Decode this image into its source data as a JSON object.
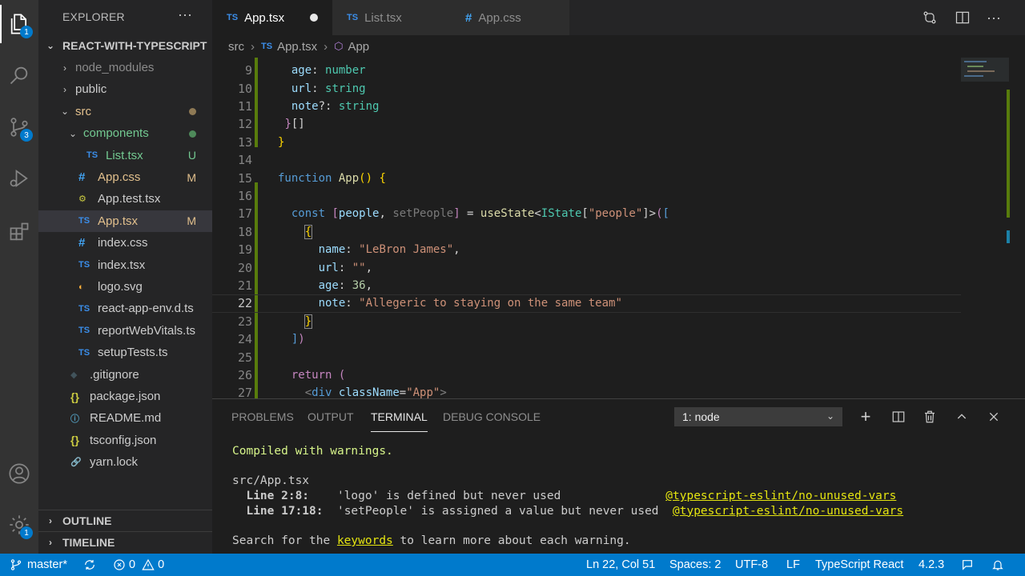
{
  "activity_bar": {
    "items": [
      {
        "name": "explorer",
        "badge": "1"
      },
      {
        "name": "search",
        "badge": ""
      },
      {
        "name": "source-control",
        "badge": "3"
      },
      {
        "name": "run-debug",
        "badge": ""
      },
      {
        "name": "extensions",
        "badge": ""
      }
    ],
    "bottom": [
      {
        "name": "accounts",
        "badge": ""
      },
      {
        "name": "manage",
        "badge": "1"
      }
    ]
  },
  "sidebar": {
    "title": "EXPLORER",
    "more": "···",
    "project": "REACT-WITH-TYPESCRIPT",
    "tree": [
      {
        "label": "node_modules",
        "type": "folder",
        "open": false,
        "color": "#8b8b8b",
        "status": ""
      },
      {
        "label": "public",
        "type": "folder",
        "open": false,
        "color": "#cccccc",
        "status": ""
      },
      {
        "label": "src",
        "type": "folder",
        "open": true,
        "color": "#e2c08d",
        "status": "dot"
      },
      {
        "label": "components",
        "type": "folder",
        "open": true,
        "color": "#73c991",
        "status": "dot-green"
      },
      {
        "label": "List.tsx",
        "type": "ts",
        "color": "#73c991",
        "status": "U"
      },
      {
        "label": "App.css",
        "type": "css",
        "color": "#e2c08d",
        "status": "M"
      },
      {
        "label": "App.test.tsx",
        "type": "test",
        "color": "#cccccc",
        "status": ""
      },
      {
        "label": "App.tsx",
        "type": "ts",
        "color": "#e2c08d",
        "status": "M"
      },
      {
        "label": "index.css",
        "type": "css",
        "color": "#cccccc",
        "status": ""
      },
      {
        "label": "index.tsx",
        "type": "ts",
        "color": "#cccccc",
        "status": ""
      },
      {
        "label": "logo.svg",
        "type": "svg",
        "color": "#cccccc",
        "status": ""
      },
      {
        "label": "react-app-env.d.ts",
        "type": "ts",
        "color": "#cccccc",
        "status": ""
      },
      {
        "label": "reportWebVitals.ts",
        "type": "ts",
        "color": "#cccccc",
        "status": ""
      },
      {
        "label": "setupTests.ts",
        "type": "ts",
        "color": "#cccccc",
        "status": ""
      },
      {
        "label": ".gitignore",
        "type": "git",
        "color": "#cccccc",
        "status": ""
      },
      {
        "label": "package.json",
        "type": "json",
        "color": "#cccccc",
        "status": ""
      },
      {
        "label": "README.md",
        "type": "info",
        "color": "#cccccc",
        "status": ""
      },
      {
        "label": "tsconfig.json",
        "type": "json",
        "color": "#cccccc",
        "status": ""
      },
      {
        "label": "yarn.lock",
        "type": "yarn",
        "color": "#cccccc",
        "status": ""
      }
    ],
    "outline": "OUTLINE",
    "timeline": "TIMELINE"
  },
  "tabs": [
    {
      "prefix": "TS",
      "label": "App.tsx",
      "active": true,
      "modified": true
    },
    {
      "prefix": "TS",
      "label": "List.tsx",
      "active": false,
      "modified": false
    },
    {
      "prefix": "#",
      "label": "App.css",
      "active": false,
      "modified": false
    }
  ],
  "breadcrumb": {
    "folder": "src",
    "file_prefix": "TS",
    "file": "App.tsx",
    "symbol": "App"
  },
  "editor": {
    "current_line": "22",
    "lines": [
      {
        "num": "9"
      },
      {
        "num": "10"
      },
      {
        "num": "11"
      },
      {
        "num": "12"
      },
      {
        "num": "13"
      },
      {
        "num": "14"
      },
      {
        "num": "15"
      },
      {
        "num": "16"
      },
      {
        "num": "17"
      },
      {
        "num": "18"
      },
      {
        "num": "19"
      },
      {
        "num": "20"
      },
      {
        "num": "21"
      },
      {
        "num": "22"
      },
      {
        "num": "23"
      },
      {
        "num": "24"
      },
      {
        "num": "25"
      },
      {
        "num": "26"
      },
      {
        "num": "27"
      }
    ]
  },
  "panel": {
    "tabs": [
      "PROBLEMS",
      "OUTPUT",
      "TERMINAL",
      "DEBUG CONSOLE"
    ],
    "active_tab": "TERMINAL",
    "terminal_select": "1: node",
    "terminal": {
      "compiled": "Compiled with warnings.",
      "file": "src/App.tsx",
      "w1_loc": "Line 2:8:",
      "w1_msg": "'logo' is defined but never used",
      "w1_rule": "@typescript-eslint/no-unused-vars",
      "w2_loc": "Line 17:18:",
      "w2_msg": "'setPeople' is assigned a value but never used",
      "w2_rule": "@typescript-eslint/no-unused-vars",
      "search_pre": "Search for the ",
      "search_kw": "keywords",
      "search_post": " to learn more about each warning."
    }
  },
  "status_bar": {
    "branch": "master*",
    "errors": "0",
    "warnings": "0",
    "position": "Ln 22, Col 51",
    "spaces": "Spaces: 2",
    "encoding": "UTF-8",
    "eol": "LF",
    "language": "TypeScript React",
    "version": "4.2.3"
  }
}
